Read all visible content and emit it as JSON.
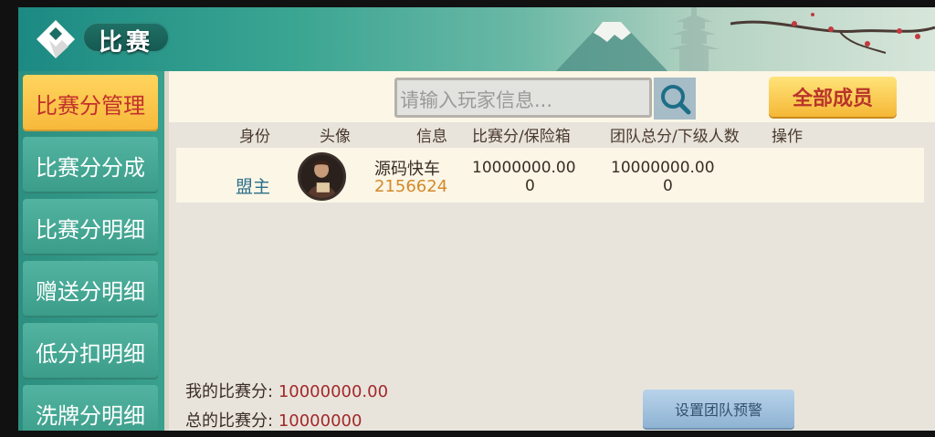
{
  "header": {
    "title": "比赛"
  },
  "sidebar": {
    "items": [
      {
        "label": "比赛分管理",
        "active": true
      },
      {
        "label": "比赛分分成"
      },
      {
        "label": "比赛分明细"
      },
      {
        "label": "赠送分明细"
      },
      {
        "label": "低分扣明细"
      },
      {
        "label": "洗牌分明细"
      }
    ]
  },
  "search": {
    "placeholder": "请输入玩家信息..."
  },
  "toolbar": {
    "all_members_label": "全部成员"
  },
  "table": {
    "headers": [
      "身份",
      "头像",
      "信息",
      "比赛分/保险箱",
      "团队总分/下级人数",
      "操作"
    ],
    "rows": [
      {
        "role": "盟主",
        "name": "源码快车",
        "id": "2156624",
        "score_line1": "10000000.00",
        "score_line2": "0",
        "team_line1": "10000000.00",
        "team_line2": "0"
      }
    ]
  },
  "footer": {
    "my_score_label": "我的比赛分:",
    "my_score_value": "10000000.00",
    "total_score_label": "总的比赛分:",
    "total_score_value": "10000000",
    "warning_button_label": "设置团队预警"
  },
  "colors": {
    "accent": "#f7b83a",
    "teal": "#3aa08e",
    "id_orange": "#d4892a",
    "role_blue": "#2c6f8a"
  }
}
